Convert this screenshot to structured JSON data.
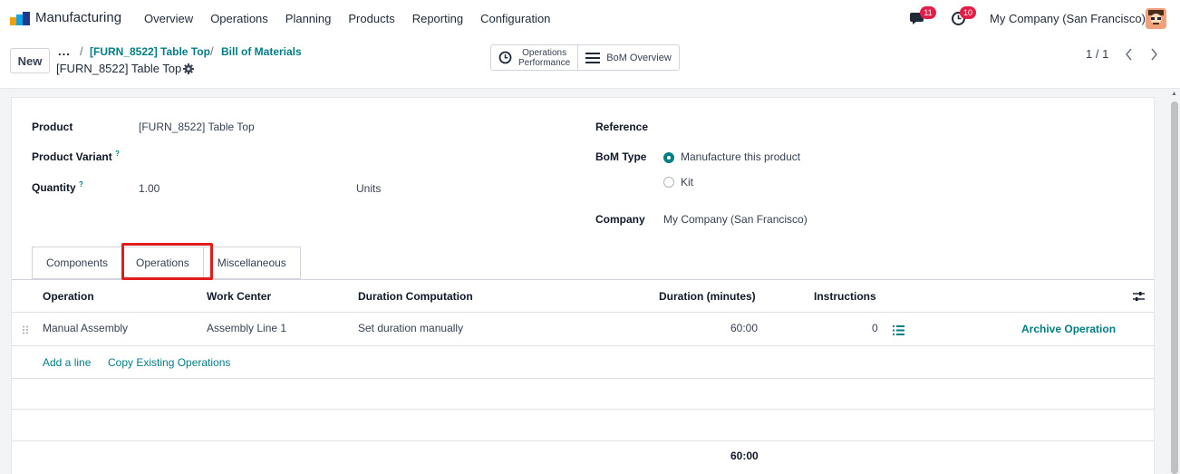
{
  "navbar": {
    "app_name": "Manufacturing",
    "menu": [
      "Overview",
      "Operations",
      "Planning",
      "Products",
      "Reporting",
      "Configuration"
    ],
    "messages_count": "11",
    "activities_count": "10",
    "company": "My Company (San Francisco)"
  },
  "control_panel": {
    "new_label": "New",
    "breadcrumb_dots": "...",
    "breadcrumb": [
      "[FURN_8522] Table Top",
      "Bill of Materials"
    ],
    "record_title": "[FURN_8522] Table Top",
    "smart_buttons": {
      "ops_perf_line1": "Operations",
      "ops_perf_line2": "Performance",
      "bom_overview": "BoM Overview"
    },
    "pager": "1 / 1"
  },
  "form": {
    "product_label": "Product",
    "product_value": "[FURN_8522] Table Top",
    "variant_label": "Product Variant",
    "quantity_label": "Quantity",
    "quantity_value": "1.00",
    "uom": "Units",
    "help_mark": "?",
    "reference_label": "Reference",
    "bom_type_label": "BoM Type",
    "bom_type_options": [
      "Manufacture this product",
      "Kit"
    ],
    "bom_type_selected": "Manufacture this product",
    "company_label": "Company",
    "company_value": "My Company (San Francisco)"
  },
  "tabs": [
    "Components",
    "Operations",
    "Miscellaneous"
  ],
  "active_tab": "Operations",
  "operations_table": {
    "columns": [
      "Operation",
      "Work Center",
      "Duration Computation",
      "Duration (minutes)",
      "Instructions"
    ],
    "rows": [
      {
        "operation": "Manual Assembly",
        "work_center": "Assembly Line 1",
        "duration_computation": "Set duration manually",
        "duration": "60:00",
        "instructions": "0",
        "action": "Archive Operation"
      }
    ],
    "add_line": "Add a line",
    "copy_existing": "Copy Existing Operations",
    "total_duration": "60:00"
  },
  "colors": {
    "accent": "#017e84",
    "highlight": "#e21b1b",
    "badge": "#e11d48"
  }
}
